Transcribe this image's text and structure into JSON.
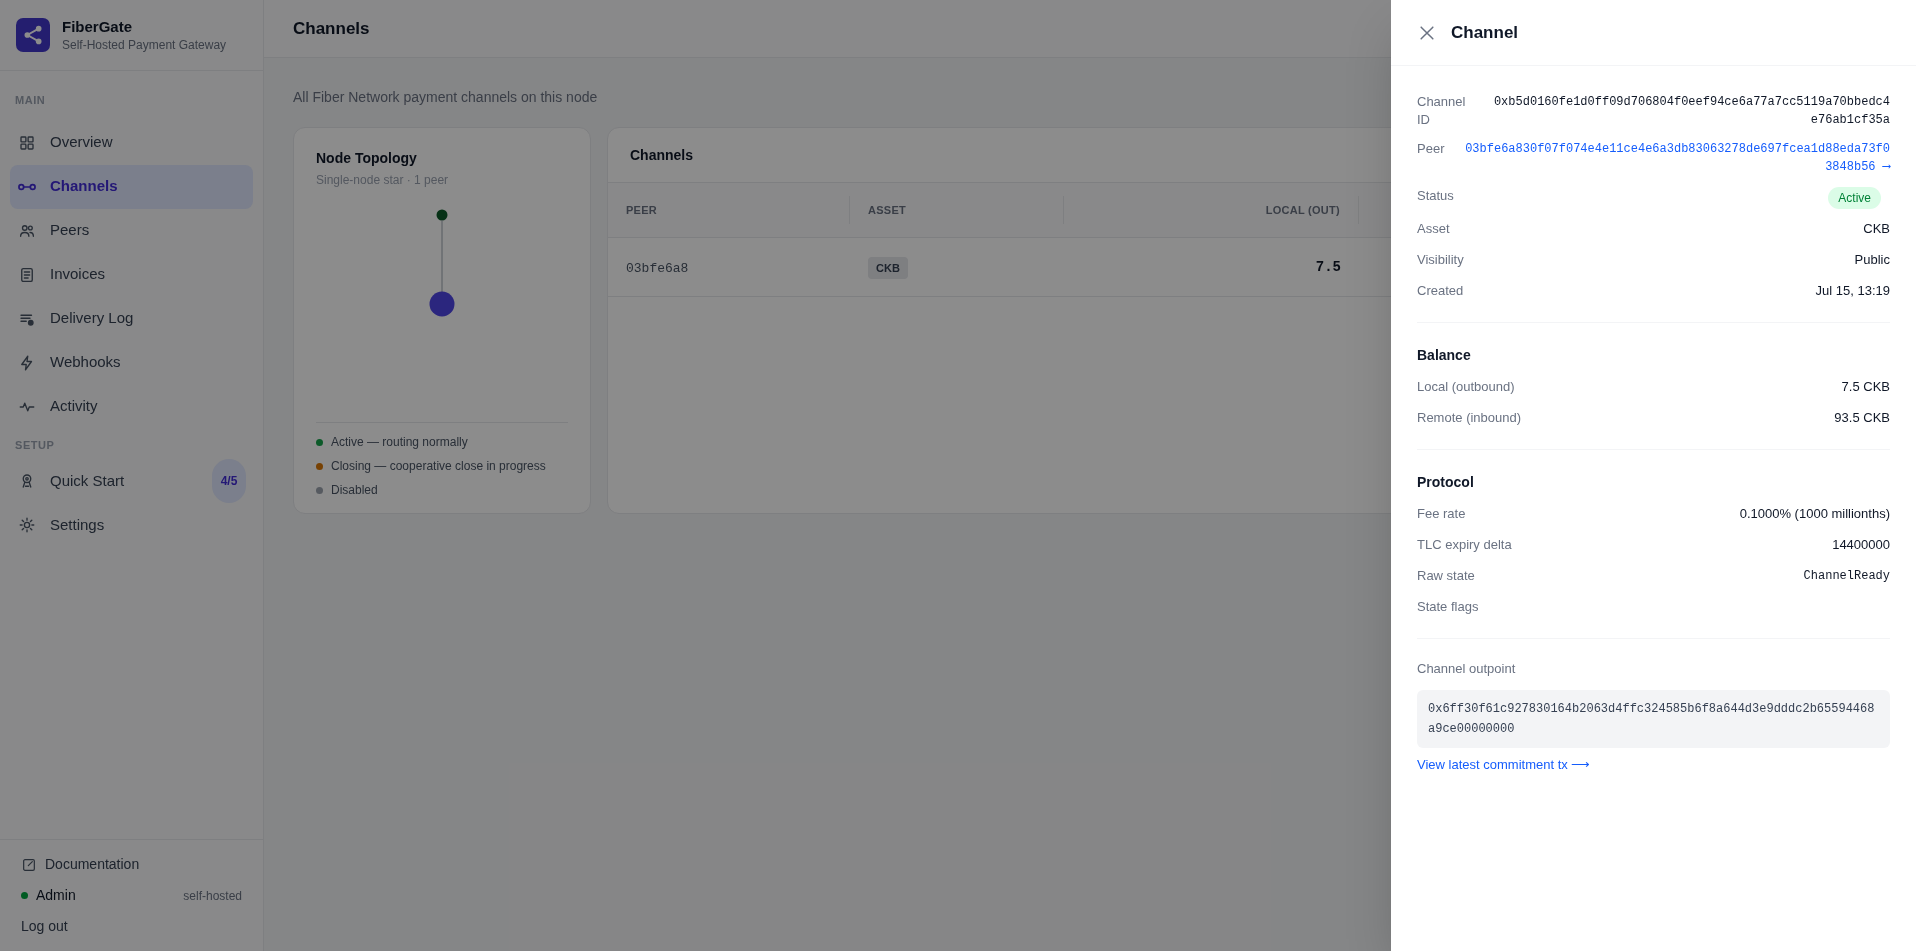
{
  "sidebar": {
    "brand": {
      "name": "FiberGate",
      "tagline": "Self-Hosted Payment Gateway"
    },
    "sections": [
      {
        "label": "MAIN",
        "items": [
          {
            "label": "Overview",
            "selected": false
          },
          {
            "label": "Channels",
            "selected": true
          },
          {
            "label": "Peers",
            "selected": false
          },
          {
            "label": "Invoices",
            "selected": false
          },
          {
            "label": "Delivery Log",
            "selected": false
          },
          {
            "label": "Webhooks",
            "selected": false
          },
          {
            "label": "Activity",
            "selected": false
          }
        ]
      },
      {
        "label": "SETUP",
        "items": [
          {
            "label": "Quick Start",
            "selected": false,
            "badge": "4/5"
          },
          {
            "label": "Settings",
            "selected": false
          }
        ]
      }
    ],
    "documentation": "Documentation",
    "user": {
      "name": "Admin",
      "online": true,
      "tag": "self-hosted"
    },
    "logout": "Log out"
  },
  "page": {
    "title": "Channels",
    "subtitle": "All Fiber Network payment channels on this node"
  },
  "topology": {
    "title": "Node Topology",
    "subtitle": "Single-node star · 1 peer",
    "legend": [
      {
        "label": "Active — routing normally",
        "color": "#0c5a29"
      },
      {
        "label": "Closing — cooperative close in progress",
        "color": "#774103"
      },
      {
        "label": "Disabled",
        "color": "#565a60"
      }
    ]
  },
  "table": {
    "title": "Channels",
    "columns": [
      "PEER",
      "ASSET",
      "LOCAL (OUT)"
    ],
    "rows": [
      {
        "peer": "03bfe6a8",
        "asset": "CKB",
        "local": "7.5"
      }
    ]
  },
  "drawer": {
    "title": "Channel",
    "sections": [
      {
        "rows": [
          {
            "label": "Channel ID",
            "value": "0xb5d0160fe1d0ff09d706804f0eef94ce6a77a7cc5119a70bbedc4e76ab1cf35a",
            "kind": "mono"
          },
          {
            "label": "Peer",
            "value": "03bfe6a830f07f074e4e11ce4e6a3db83063278de697fcea1d88eda73f03848b56 ⟶",
            "kind": "link"
          },
          {
            "label": "Status",
            "value": "Active",
            "kind": "badge"
          },
          {
            "label": "Asset",
            "value": "CKB",
            "kind": "text"
          },
          {
            "label": "Visibility",
            "value": "Public",
            "kind": "text"
          },
          {
            "label": "Created",
            "value": "Jul 15, 13:19",
            "kind": "text"
          }
        ]
      },
      {
        "heading": "Balance",
        "rows": [
          {
            "label": "Local (outbound)",
            "value": "7.5 CKB",
            "kind": "text"
          },
          {
            "label": "Remote (inbound)",
            "value": "93.5 CKB",
            "kind": "text"
          }
        ]
      },
      {
        "heading": "Protocol",
        "rows": [
          {
            "label": "Fee rate",
            "value": "0.1000% (1000 millionths)",
            "kind": "text"
          },
          {
            "label": "TLC expiry delta",
            "value": "14400000",
            "kind": "text"
          },
          {
            "label": "Raw state",
            "value": "ChannelReady",
            "kind": "code"
          },
          {
            "label": "State flags",
            "kind": "text"
          }
        ]
      }
    ],
    "outpoint": {
      "label": "Channel outpoint",
      "value": "0x6ff30f61c927830164b2063d4ffc324585b6f8a644d3e9dddc2b65594468a9ce00000000"
    },
    "link": "View latest commitment tx ⟶"
  }
}
